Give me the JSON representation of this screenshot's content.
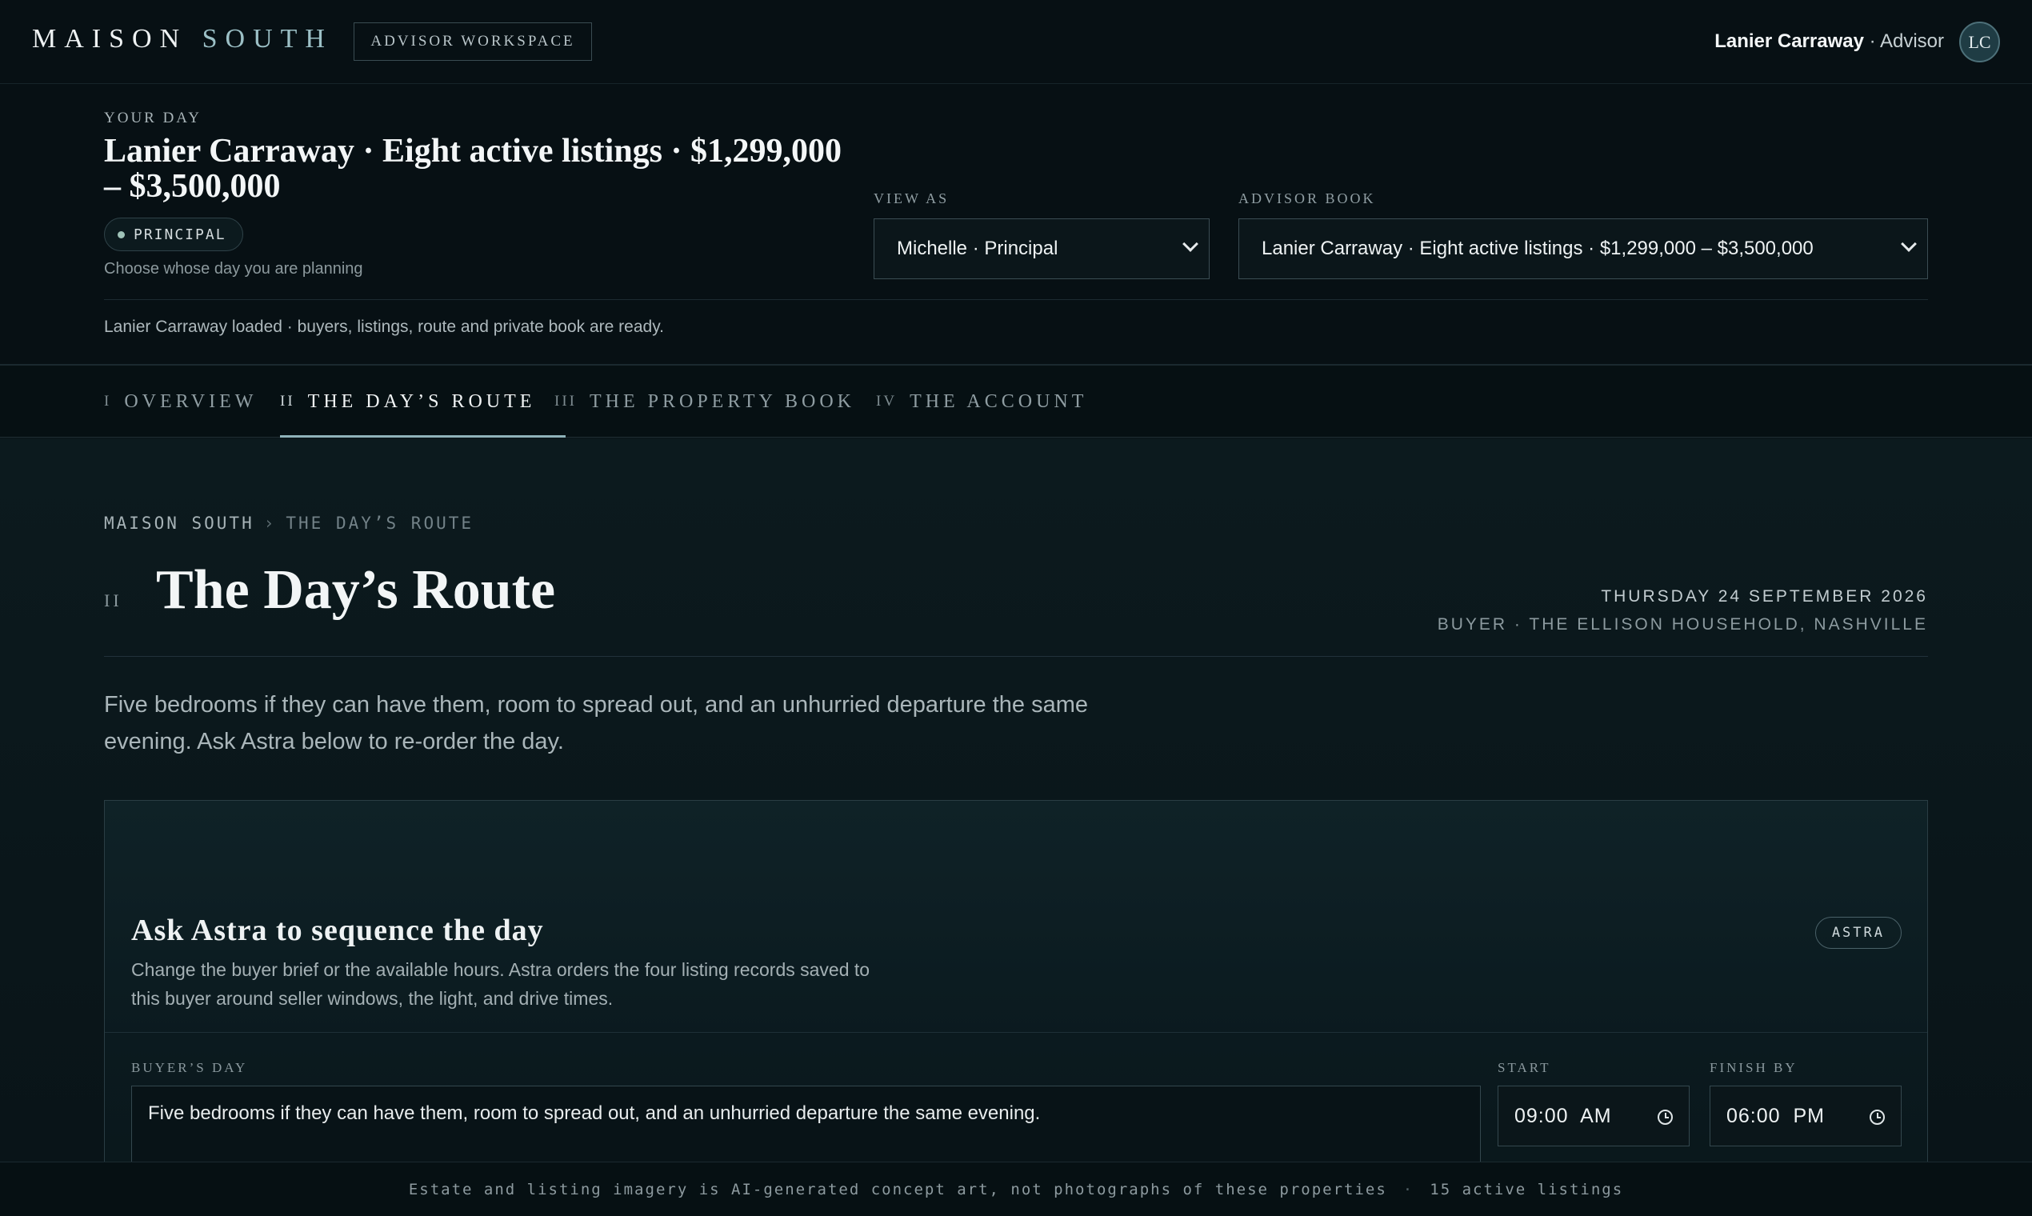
{
  "topbar": {
    "brand_primary": "MAISON",
    "brand_secondary": "SOUTH",
    "workspace_chip": "ADVISOR WORKSPACE",
    "user_name": "Lanier Carraway",
    "user_role": "· Advisor",
    "avatar_initials": "LC"
  },
  "day": {
    "eyebrow": "YOUR DAY",
    "title": "Lanier Carraway · Eight active listings · $1,299,000 – $3,500,000",
    "role_badge": "PRINCIPAL",
    "hint": "Choose whose day you are planning",
    "view_as_label": "VIEW AS",
    "view_as_value": "Michelle · Principal",
    "advisor_book_label": "ADVISOR BOOK",
    "advisor_book_value": "Lanier Carraway · Eight active listings · $1,299,000 – $3,500,000",
    "status": "Lanier Carraway loaded · buyers, listings, route and private book are ready."
  },
  "tabs": [
    {
      "num": "I",
      "label": "OVERVIEW"
    },
    {
      "num": "II",
      "label": "THE DAY’S ROUTE"
    },
    {
      "num": "III",
      "label": "THE PROPERTY BOOK"
    },
    {
      "num": "IV",
      "label": "THE ACCOUNT"
    }
  ],
  "active_tab": "THE DAY’S ROUTE",
  "main": {
    "breadcrumb": [
      "MAISON SOUTH",
      "›",
      "THE DAY’S ROUTE"
    ],
    "section_num": "II",
    "title": "The Day’s Route",
    "date": "THURSDAY 24 SEPTEMBER 2026",
    "buyer": "BUYER · THE ELLISON HOUSEHOLD, NASHVILLE",
    "intro": "Five bedrooms if they can have them, room to spread out, and an unhurried departure the same evening. Ask Astra below to re-order the day."
  },
  "astra": {
    "title": "Ask Astra to sequence the day",
    "description": "Change the buyer brief or the available hours. Astra orders the four listing records saved to this buyer around seller windows, the light, and drive times.",
    "badge": "ASTRA",
    "brief_label": "BUYER’S DAY",
    "brief_value": "Five bedrooms if they can have them, room to spread out, and an unhurried departure the same evening.",
    "start_label": "START",
    "start_value": "09:00  AM",
    "finish_label": "FINISH BY",
    "finish_value": "06:00  PM"
  },
  "footer": {
    "disclaimer": "Estate and listing imagery is AI-generated concept art, not photographs of these properties",
    "separator": "·",
    "count": "15 active listings"
  }
}
